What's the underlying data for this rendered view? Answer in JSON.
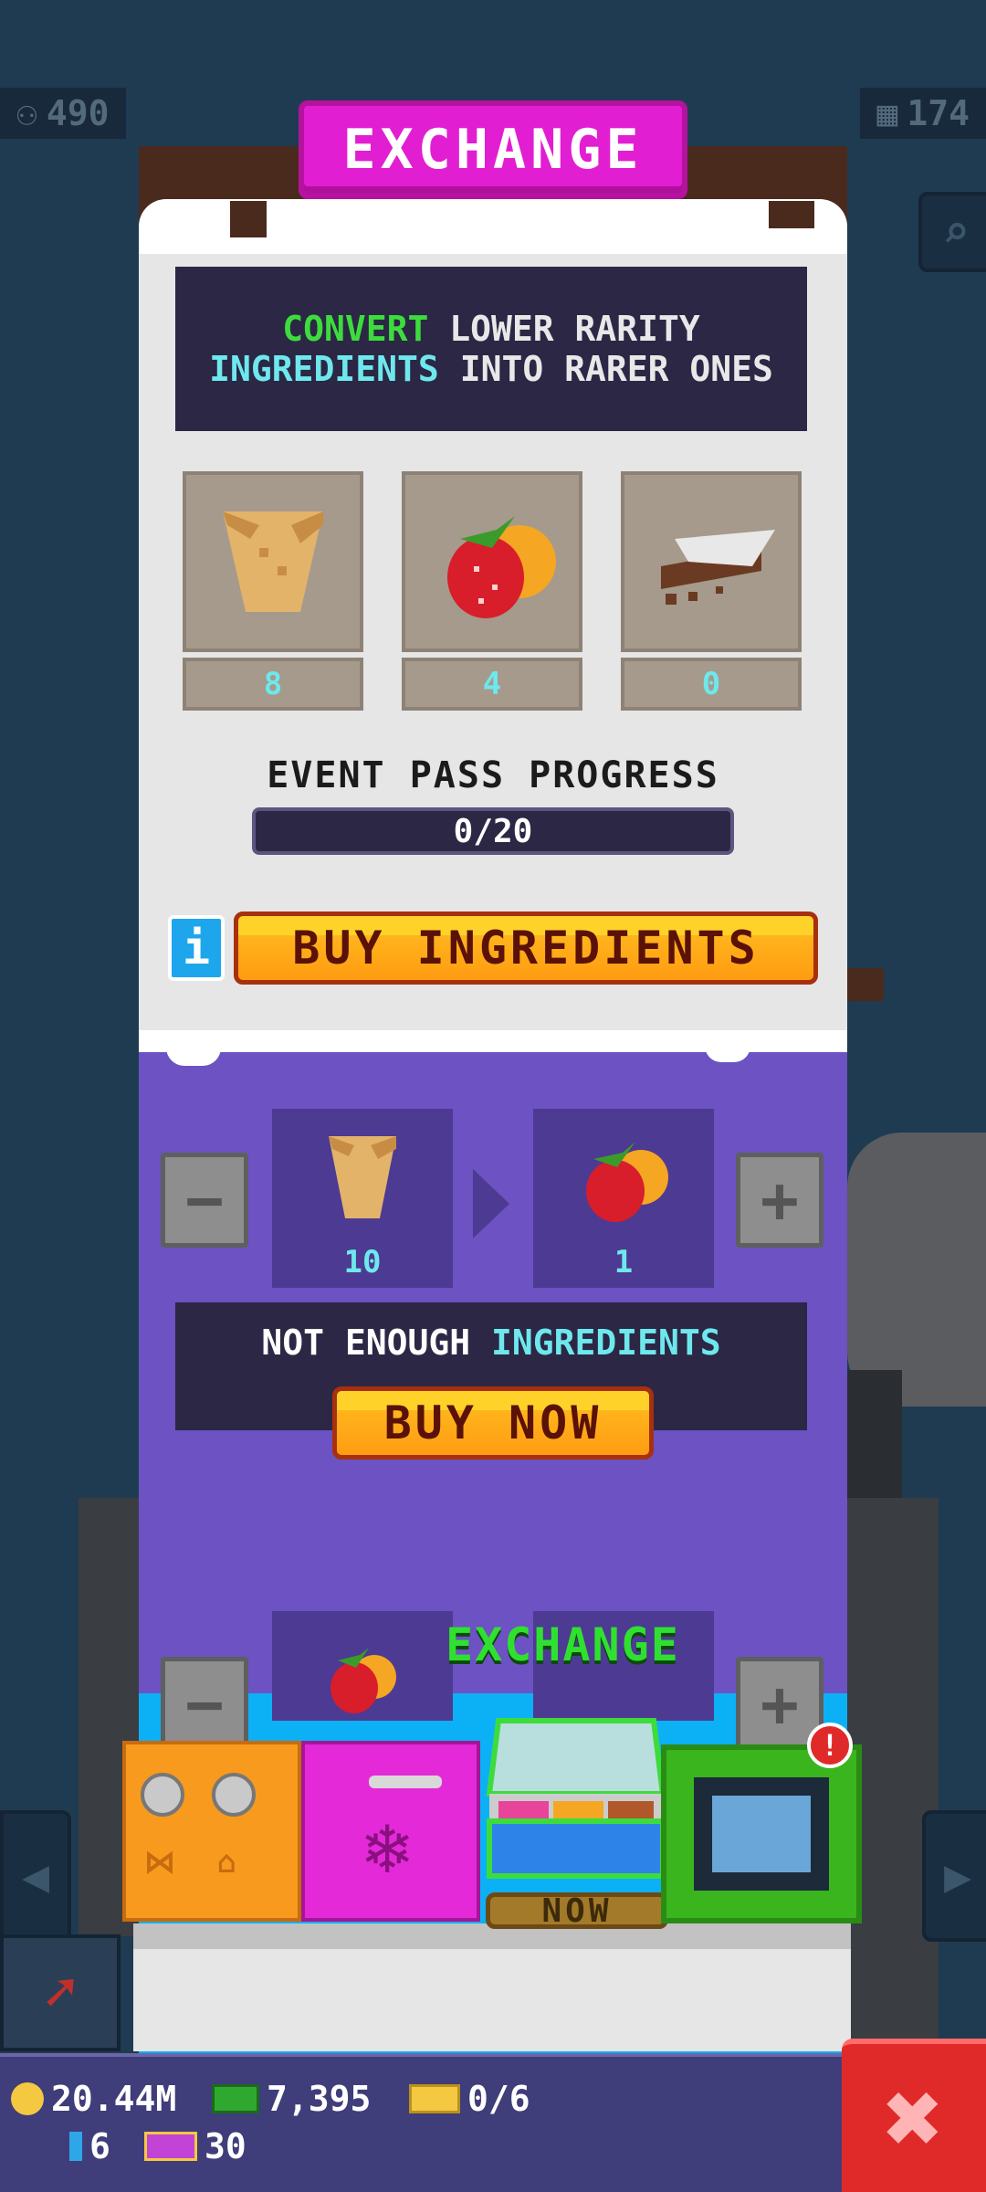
{
  "hud": {
    "population": "490",
    "floors": "174"
  },
  "panel": {
    "title": "EXCHANGE",
    "description_part1_highlight": "CONVERT",
    "description_part1_rest": " LOWER RARITY",
    "description_part2_highlight": "INGREDIENTS",
    "description_part2_rest": " INTO RARER ONES",
    "ingredients": [
      {
        "name": "cone-ingredient",
        "count": "8"
      },
      {
        "name": "berries-ingredient",
        "count": "4"
      },
      {
        "name": "chocolate-ingredient",
        "count": "0"
      }
    ],
    "event_pass_label": "EVENT PASS PROGRESS",
    "event_pass_progress": "0/20",
    "event_pass_fraction": 0,
    "info_button_label": "i",
    "buy_ingredients_label": "BUY INGREDIENTS"
  },
  "conversion": {
    "minus_label": "−",
    "plus_label": "+",
    "from_count": "10",
    "to_count": "1",
    "not_enough_text": "NOT ENOUGH",
    "not_enough_highlight": "INGREDIENTS",
    "buy_now_label": "BUY NOW"
  },
  "conversion2": {
    "minus_label": "−",
    "plus_label": "+",
    "exchange_label": "EXCHANGE",
    "partial_button_label": "NOW"
  },
  "machines": {
    "alert_badge": "!"
  },
  "bottom_bar": {
    "coins": "20.44M",
    "cash": "7,395",
    "tickets": "0/6",
    "gems": "6",
    "tokens": "30",
    "close_label": "✖"
  },
  "colors": {
    "banner": "#e21ed2",
    "white_section": "#e6e6e6",
    "purple_section": "#6c52c2",
    "blue_section": "#0cb1f5",
    "highlight_green": "#3ddc3d",
    "highlight_cyan": "#6ee8ec",
    "button_yellow": "#ffb41c",
    "close_red": "#e02a2a"
  }
}
